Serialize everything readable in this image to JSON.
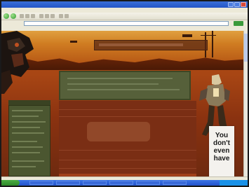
{
  "card": {
    "lines": [
      "You",
      "don't",
      "even",
      "have"
    ]
  },
  "colors": {
    "page_orange": "#b4531a",
    "panel_green": "#56603a",
    "content_red": "#7a2e14",
    "taskbar_blue": "#2253cc"
  },
  "icons": [
    "back-icon",
    "forward-icon",
    "go-icon",
    "start-icon"
  ]
}
